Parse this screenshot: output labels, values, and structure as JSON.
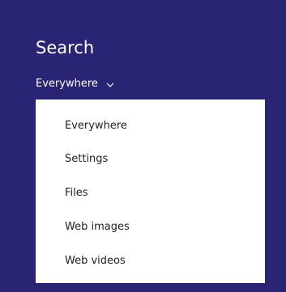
{
  "header": {
    "title": "Search"
  },
  "scope": {
    "selected": "Everywhere",
    "icon": "chevron-down-icon"
  },
  "dropdown": {
    "options": [
      {
        "label": "Everywhere"
      },
      {
        "label": "Settings"
      },
      {
        "label": "Files"
      },
      {
        "label": "Web images"
      },
      {
        "label": "Web videos"
      }
    ]
  },
  "colors": {
    "background": "#2a2475",
    "dropdown_bg": "#ffffff",
    "text_dark": "#222222",
    "text_light": "#ffffff"
  }
}
